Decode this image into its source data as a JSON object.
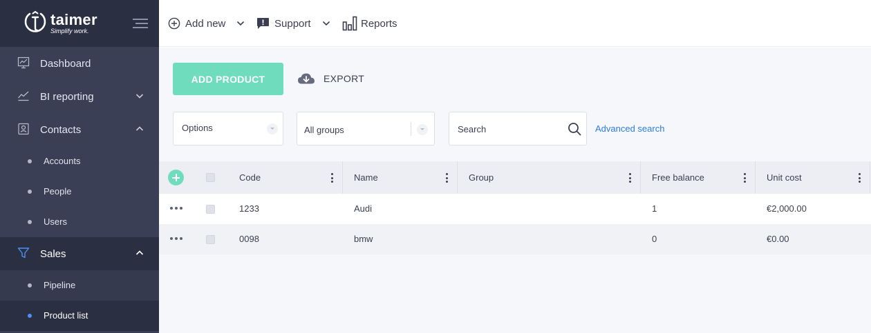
{
  "brand": {
    "name": "taimer",
    "tagline": "Simplify work."
  },
  "sidebar": {
    "items": [
      {
        "label": "Dashboard",
        "icon": "dashboard-icon"
      },
      {
        "label": "BI reporting",
        "icon": "chart-line-icon"
      },
      {
        "label": "Contacts",
        "icon": "contacts-icon"
      },
      {
        "label": "Sales",
        "icon": "funnel-icon"
      }
    ],
    "contacts_sub": [
      "Accounts",
      "People",
      "Users"
    ],
    "sales_sub": [
      "Pipeline",
      "Product list"
    ]
  },
  "topbar": {
    "add_new": "Add new",
    "support": "Support",
    "reports": "Reports"
  },
  "toolbar": {
    "add_product": "ADD PRODUCT",
    "export": "EXPORT"
  },
  "filters": {
    "options": "Options",
    "groups": "All groups",
    "search_placeholder": "Search",
    "advanced_search": "Advanced search"
  },
  "table": {
    "columns": [
      "Code",
      "Name",
      "Group",
      "Free balance",
      "Unit cost"
    ],
    "rows": [
      {
        "code": "1233",
        "name": "Audi",
        "group": "",
        "free_balance": "1",
        "unit_cost": "€2,000.00"
      },
      {
        "code": "0098",
        "name": "bmw",
        "group": "",
        "free_balance": "0",
        "unit_cost": "€0.00"
      }
    ]
  },
  "colors": {
    "accent": "#6fdcbd",
    "sidebar": "#3a3f55",
    "sidebar_dark": "#2b2f42",
    "link": "#2c7be5",
    "active_dot": "#4e8ff8"
  }
}
